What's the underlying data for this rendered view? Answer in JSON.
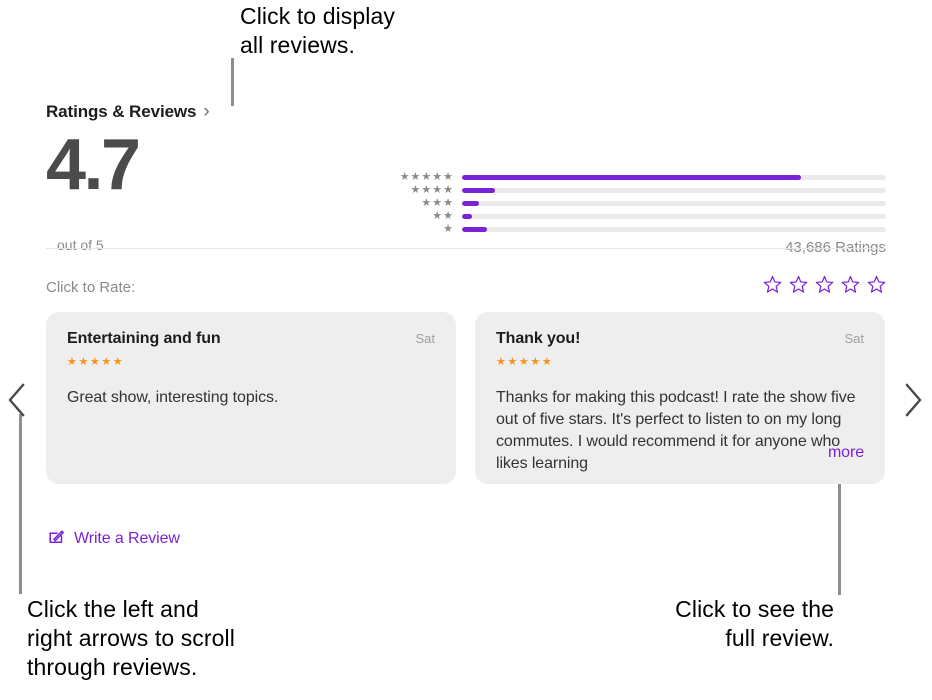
{
  "annotations": {
    "top_left": "Click to display\nall reviews.",
    "bottom_left": "Click the left and\nright arrows to scroll\nthrough reviews.",
    "bottom_right": "Click to see the\nfull review."
  },
  "section": {
    "heading": "Ratings & Reviews",
    "chevron": "›",
    "score": "4.7",
    "out_of": "out of 5",
    "ratings_count": "43,686 Ratings",
    "accent_color": "#7b21d6",
    "star_color": "#f7921e",
    "histogram_star_color": "#8a8a8e"
  },
  "chart_data": {
    "type": "bar",
    "title": "Ratings & Reviews",
    "orientation": "horizontal",
    "categories": [
      "★★★★★",
      "★★★★",
      "★★★",
      "★★",
      "★"
    ],
    "star_counts": [
      5,
      4,
      3,
      2,
      1
    ],
    "values": [
      80,
      7.7,
      4.1,
      2.4,
      5.8
    ],
    "ylabel": "",
    "xlabel": "",
    "xlim": [
      0,
      100
    ],
    "grid": false,
    "legend": false,
    "average": 4.7,
    "total_label": "43,686 Ratings"
  },
  "rate": {
    "label": "Click to Rate:",
    "stars": [
      "☆",
      "☆",
      "☆",
      "☆",
      "☆"
    ]
  },
  "reviews": [
    {
      "title": "Entertaining and fun",
      "date": "Sat",
      "stars": "★★★★★",
      "body": "Great show, interesting topics.",
      "clipped": false,
      "more_label": ""
    },
    {
      "title": "Thank you!",
      "date": "Sat",
      "stars": "★★★★★",
      "body": "Thanks for making this podcast! I rate the show five out of five stars. It's perfect to listen to on my long commutes. I would recommend it for anyone who likes learning",
      "clipped": true,
      "more_label": "more"
    }
  ],
  "write_review": {
    "label": "Write a Review"
  },
  "nav": {
    "prev_label": "Previous reviews",
    "next_label": "Next reviews"
  }
}
